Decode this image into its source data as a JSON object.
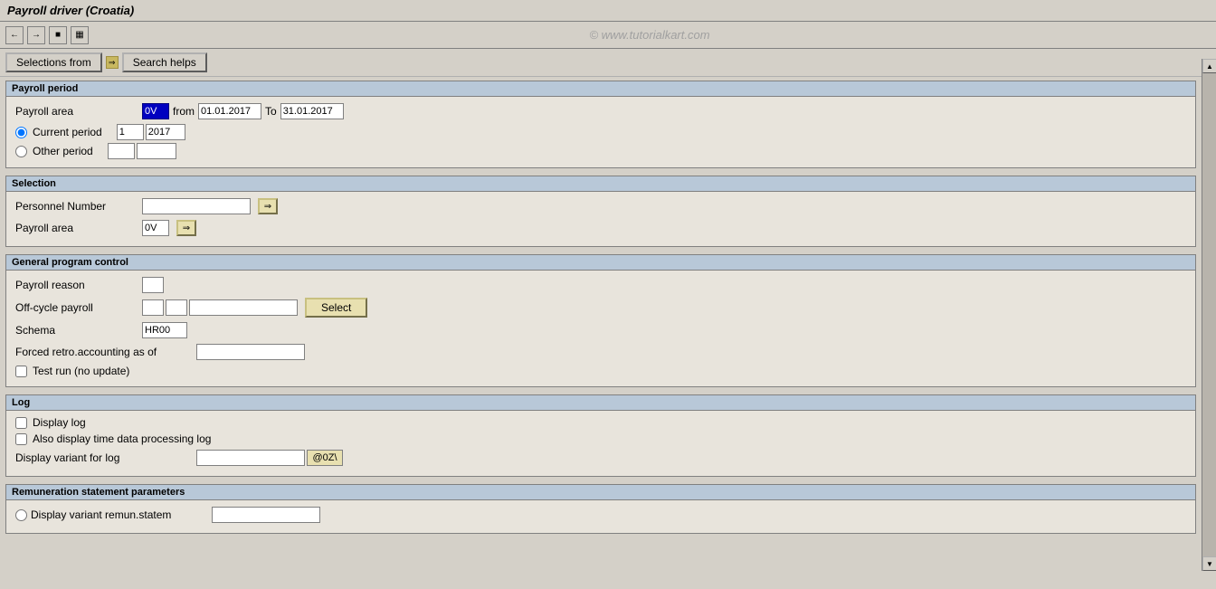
{
  "title": "Payroll driver (Croatia)",
  "watermark": "© www.tutorialkart.com",
  "toolbar": {
    "icons": [
      "back-icon",
      "forward-icon",
      "save-icon",
      "local-layout-icon"
    ]
  },
  "top_buttons": {
    "selections_label": "Selections from",
    "arrow_label": "⇒",
    "search_helps_label": "Search helps"
  },
  "sections": {
    "payroll_period": {
      "header": "Payroll period",
      "payroll_area": {
        "label": "Payroll area",
        "value": "0V",
        "from_label": "from",
        "from_value": "01.01.2017",
        "to_label": "To",
        "to_value": "31.01.2017"
      },
      "current_period": {
        "label": "Current period",
        "period_value": "1",
        "year_value": "2017"
      },
      "other_period": {
        "label": "Other period",
        "period_value": "",
        "year_value": ""
      }
    },
    "selection": {
      "header": "Selection",
      "personnel_number": {
        "label": "Personnel Number",
        "value": ""
      },
      "payroll_area": {
        "label": "Payroll area",
        "value": "0V"
      }
    },
    "general_program_control": {
      "header": "General program control",
      "payroll_reason": {
        "label": "Payroll reason",
        "value": ""
      },
      "off_cycle_payroll": {
        "label": "Off-cycle payroll",
        "value1": "",
        "value2": "",
        "select_btn": "Select"
      },
      "schema": {
        "label": "Schema",
        "value": "HR00"
      },
      "forced_retro": {
        "label": "Forced retro.accounting as of",
        "value": ""
      },
      "test_run": {
        "label": "Test run (no update)"
      }
    },
    "log": {
      "header": "Log",
      "display_log": {
        "label": "Display log"
      },
      "display_time_data": {
        "label": "Also display time data processing log"
      },
      "display_variant": {
        "label": "Display variant for log",
        "value": "",
        "suffix": "@0Z\\"
      }
    },
    "remuneration": {
      "header": "Remuneration statement parameters",
      "display_variant_remun": {
        "label": "Display variant remun.statem",
        "value": ""
      }
    }
  }
}
